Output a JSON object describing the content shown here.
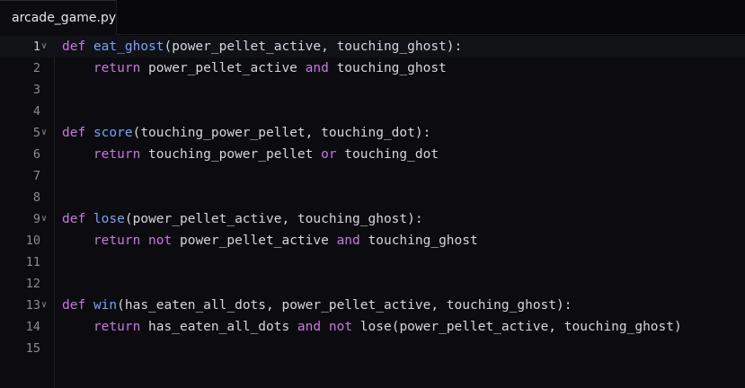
{
  "colors": {
    "background": "#0c0c10",
    "keyword": "#c678dd",
    "function": "#7aa2f7",
    "text": "#d4d4dc",
    "line_number": "#8a8a94"
  },
  "tab": {
    "filename": "arcade_game.py"
  },
  "fold_icon": "chevron-down-icon",
  "lines": [
    {
      "num": "1",
      "fold": true,
      "active": true,
      "tokens": [
        {
          "t": "kw",
          "v": "def"
        },
        {
          "t": "pn",
          "v": " "
        },
        {
          "t": "fn",
          "v": "eat_ghost"
        },
        {
          "t": "pn",
          "v": "(power_pellet_active, touching_ghost):"
        }
      ]
    },
    {
      "num": "2",
      "fold": false,
      "tokens": [
        {
          "t": "pn",
          "v": "    "
        },
        {
          "t": "kw",
          "v": "return"
        },
        {
          "t": "id",
          "v": " power_pellet_active "
        },
        {
          "t": "kw",
          "v": "and"
        },
        {
          "t": "id",
          "v": " touching_ghost"
        }
      ]
    },
    {
      "num": "3",
      "fold": false,
      "tokens": []
    },
    {
      "num": "4",
      "fold": false,
      "tokens": []
    },
    {
      "num": "5",
      "fold": true,
      "tokens": [
        {
          "t": "kw",
          "v": "def"
        },
        {
          "t": "pn",
          "v": " "
        },
        {
          "t": "fn",
          "v": "score"
        },
        {
          "t": "pn",
          "v": "(touching_power_pellet, touching_dot):"
        }
      ]
    },
    {
      "num": "6",
      "fold": false,
      "tokens": [
        {
          "t": "pn",
          "v": "    "
        },
        {
          "t": "kw",
          "v": "return"
        },
        {
          "t": "id",
          "v": " touching_power_pellet "
        },
        {
          "t": "kw",
          "v": "or"
        },
        {
          "t": "id",
          "v": " touching_dot"
        }
      ]
    },
    {
      "num": "7",
      "fold": false,
      "tokens": []
    },
    {
      "num": "8",
      "fold": false,
      "tokens": []
    },
    {
      "num": "9",
      "fold": true,
      "tokens": [
        {
          "t": "kw",
          "v": "def"
        },
        {
          "t": "pn",
          "v": " "
        },
        {
          "t": "fn",
          "v": "lose"
        },
        {
          "t": "pn",
          "v": "(power_pellet_active, touching_ghost):"
        }
      ]
    },
    {
      "num": "10",
      "fold": false,
      "tokens": [
        {
          "t": "pn",
          "v": "    "
        },
        {
          "t": "kw",
          "v": "return"
        },
        {
          "t": "pn",
          "v": " "
        },
        {
          "t": "kw",
          "v": "not"
        },
        {
          "t": "id",
          "v": " power_pellet_active "
        },
        {
          "t": "kw",
          "v": "and"
        },
        {
          "t": "id",
          "v": " touching_ghost"
        }
      ]
    },
    {
      "num": "11",
      "fold": false,
      "tokens": []
    },
    {
      "num": "12",
      "fold": false,
      "tokens": []
    },
    {
      "num": "13",
      "fold": true,
      "tokens": [
        {
          "t": "kw",
          "v": "def"
        },
        {
          "t": "pn",
          "v": " "
        },
        {
          "t": "fn",
          "v": "win"
        },
        {
          "t": "pn",
          "v": "(has_eaten_all_dots, power_pellet_active, touching_ghost):"
        }
      ]
    },
    {
      "num": "14",
      "fold": false,
      "tokens": [
        {
          "t": "pn",
          "v": "    "
        },
        {
          "t": "kw",
          "v": "return"
        },
        {
          "t": "id",
          "v": " has_eaten_all_dots "
        },
        {
          "t": "kw",
          "v": "and"
        },
        {
          "t": "pn",
          "v": " "
        },
        {
          "t": "kw",
          "v": "not"
        },
        {
          "t": "id",
          "v": " lose(power_pellet_active, touching_ghost)"
        }
      ]
    },
    {
      "num": "15",
      "fold": false,
      "tokens": []
    }
  ]
}
